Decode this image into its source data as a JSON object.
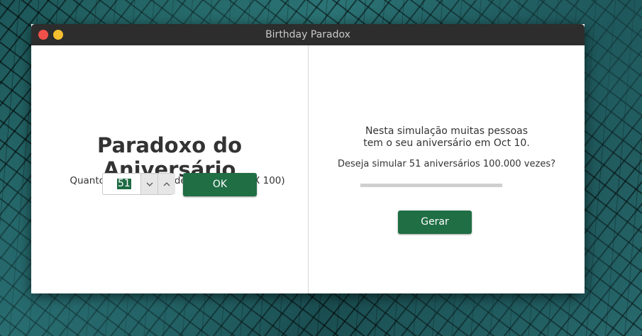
{
  "window": {
    "title": "Birthday Paradox"
  },
  "left": {
    "title": "Paradoxo do Aniversário",
    "prompt": "Quantos aniversários devo gerar? (MAX 100)",
    "spinner_value": "51",
    "ok_label": "OK"
  },
  "right": {
    "message_line1": "Nesta simulação muitas pessoas",
    "message_line2": "tem o seu aniversário em Oct 10.",
    "question": "Deseja simular 51 aniversários 100.000 vezes?",
    "progress": 0,
    "gerar_label": "Gerar"
  },
  "colors": {
    "accent": "#1f6e44",
    "titlebar": "#2d2d2d",
    "close": "#f0504a",
    "minimize": "#f4bf2f"
  },
  "icons": {
    "spin_down": "chevron-down-icon",
    "spin_up": "chevron-up-icon"
  }
}
